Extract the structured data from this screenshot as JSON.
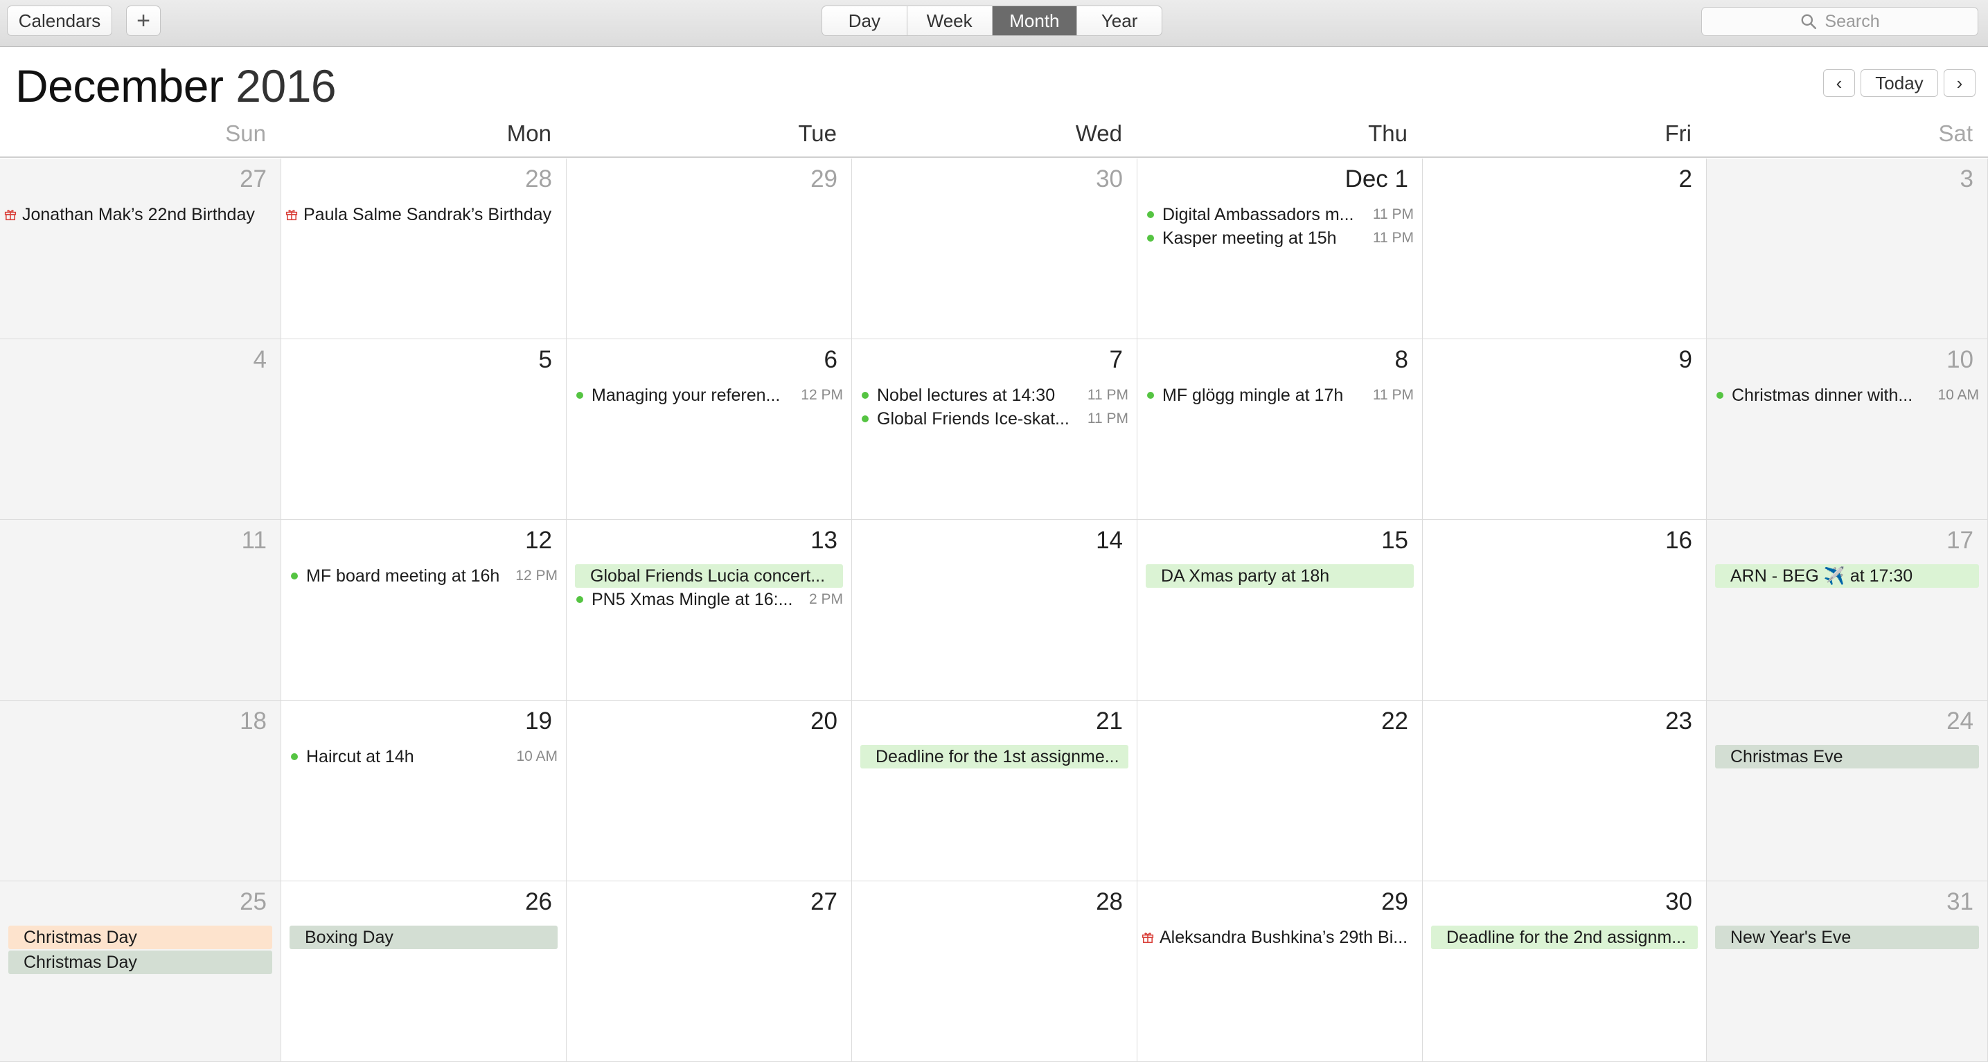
{
  "toolbar": {
    "calendars_label": "Calendars",
    "add_label": "+",
    "view_tabs": [
      {
        "label": "Day",
        "active": false
      },
      {
        "label": "Week",
        "active": false
      },
      {
        "label": "Month",
        "active": true
      },
      {
        "label": "Year",
        "active": false
      }
    ],
    "search_placeholder": "Search"
  },
  "header": {
    "month": "December",
    "year": "2016",
    "prev_icon": "‹",
    "today_label": "Today",
    "next_icon": "›"
  },
  "weekdays": [
    "Sun",
    "Mon",
    "Tue",
    "Wed",
    "Thu",
    "Fri",
    "Sat"
  ],
  "colors": {
    "dot_green": "#55c442",
    "bar_green": "#dbf3d4",
    "bar_grey": "#d3ded3",
    "bar_peach": "#fde3cd",
    "gift_red": "#d9403a"
  },
  "weeks": [
    [
      {
        "day": "27",
        "muted": true,
        "events": [
          {
            "kind": "birthday",
            "title": "Jonathan Mak’s 22nd Birthday"
          }
        ]
      },
      {
        "day": "28",
        "muted": true,
        "events": [
          {
            "kind": "birthday",
            "title": "Paula Salme Sandrak’s Birthday"
          }
        ]
      },
      {
        "day": "29",
        "muted": true,
        "events": []
      },
      {
        "day": "30",
        "muted": true,
        "events": []
      },
      {
        "day": "Dec 1",
        "muted": false,
        "events": [
          {
            "kind": "timed",
            "title": "Digital Ambassadors m...",
            "time": "11 PM"
          },
          {
            "kind": "timed",
            "title": "Kasper meeting at 15h",
            "time": "11 PM"
          }
        ]
      },
      {
        "day": "2",
        "muted": false,
        "events": []
      },
      {
        "day": "3",
        "muted": false,
        "events": []
      }
    ],
    [
      {
        "day": "4",
        "muted": false,
        "events": []
      },
      {
        "day": "5",
        "muted": false,
        "events": []
      },
      {
        "day": "6",
        "muted": false,
        "events": [
          {
            "kind": "timed",
            "title": "Managing your referen...",
            "time": "12 PM"
          }
        ]
      },
      {
        "day": "7",
        "muted": false,
        "events": [
          {
            "kind": "timed",
            "title": "Nobel lectures at 14:30",
            "time": "11 PM"
          },
          {
            "kind": "timed",
            "title": "Global Friends Ice-skat...",
            "time": "11 PM"
          }
        ]
      },
      {
        "day": "8",
        "muted": false,
        "events": [
          {
            "kind": "timed",
            "title": "MF glögg mingle at 17h",
            "time": "11 PM"
          }
        ]
      },
      {
        "day": "9",
        "muted": false,
        "events": []
      },
      {
        "day": "10",
        "muted": false,
        "events": [
          {
            "kind": "timed",
            "title": "Christmas dinner with...",
            "time": "10 AM"
          }
        ]
      }
    ],
    [
      {
        "day": "11",
        "muted": false,
        "events": []
      },
      {
        "day": "12",
        "muted": false,
        "events": [
          {
            "kind": "timed",
            "title": "MF board meeting at 16h",
            "time": "12 PM"
          }
        ]
      },
      {
        "day": "13",
        "muted": false,
        "events": [
          {
            "kind": "allday",
            "color": "green",
            "title": "Global Friends Lucia concert..."
          },
          {
            "kind": "timed",
            "title": "PN5 Xmas Mingle at 16:...",
            "time": "2 PM"
          }
        ]
      },
      {
        "day": "14",
        "muted": false,
        "events": []
      },
      {
        "day": "15",
        "muted": false,
        "events": [
          {
            "kind": "allday",
            "color": "green",
            "title": "DA Xmas party at 18h"
          }
        ]
      },
      {
        "day": "16",
        "muted": false,
        "events": []
      },
      {
        "day": "17",
        "muted": false,
        "events": [
          {
            "kind": "allday",
            "color": "green",
            "title": "ARN - BEG ✈️ at 17:30"
          }
        ]
      }
    ],
    [
      {
        "day": "18",
        "muted": false,
        "events": []
      },
      {
        "day": "19",
        "muted": false,
        "events": [
          {
            "kind": "timed",
            "title": "Haircut at 14h",
            "time": "10 AM"
          }
        ]
      },
      {
        "day": "20",
        "muted": false,
        "events": []
      },
      {
        "day": "21",
        "muted": false,
        "events": [
          {
            "kind": "allday",
            "color": "green",
            "title": "Deadline for the 1st assignme..."
          }
        ]
      },
      {
        "day": "22",
        "muted": false,
        "events": []
      },
      {
        "day": "23",
        "muted": false,
        "events": []
      },
      {
        "day": "24",
        "muted": false,
        "events": [
          {
            "kind": "allday",
            "color": "grey",
            "title": "Christmas Eve"
          }
        ]
      }
    ],
    [
      {
        "day": "25",
        "muted": false,
        "events": [
          {
            "kind": "allday",
            "color": "peach",
            "title": "Christmas Day"
          },
          {
            "kind": "allday",
            "color": "grey",
            "title": "Christmas Day"
          }
        ]
      },
      {
        "day": "26",
        "muted": false,
        "events": [
          {
            "kind": "allday",
            "color": "grey",
            "title": "Boxing Day"
          }
        ]
      },
      {
        "day": "27",
        "muted": false,
        "events": []
      },
      {
        "day": "28",
        "muted": false,
        "events": []
      },
      {
        "day": "29",
        "muted": false,
        "events": [
          {
            "kind": "birthday",
            "title": "Aleksandra Bushkina’s 29th Bi..."
          }
        ]
      },
      {
        "day": "30",
        "muted": false,
        "events": [
          {
            "kind": "allday",
            "color": "green",
            "title": "Deadline for the 2nd assignm..."
          }
        ]
      },
      {
        "day": "31",
        "muted": false,
        "events": [
          {
            "kind": "allday",
            "color": "grey",
            "title": "New Year's Eve"
          }
        ]
      }
    ]
  ]
}
